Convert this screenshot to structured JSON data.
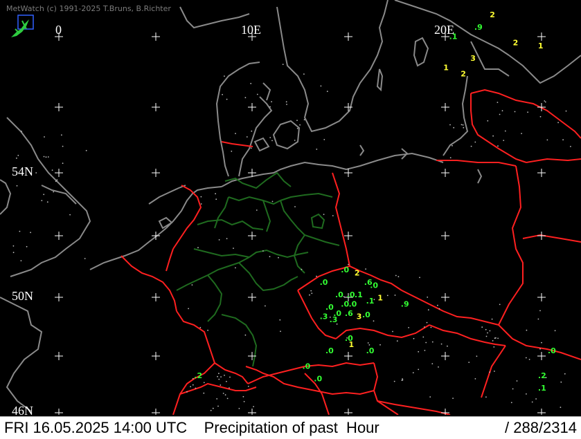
{
  "header": {
    "credit": "MetWatch  (c) 1991-2025 T.Bruns, B.Richter"
  },
  "grid_labels": {
    "lon_0": "0",
    "lon_10": "10E",
    "lon_20": "20E",
    "lat_54": "54N",
    "lat_50": "50N",
    "lat_46": "46N"
  },
  "footer": {
    "datetime": "FRI 16.05.2025 14:00 UTC",
    "title": "Precipitation of past  Hour",
    "count": "/ 288/2314"
  },
  "colors": {
    "background": "#000000",
    "coast": "#8a8a8a",
    "border": "#ff1a1a",
    "state_border": "#1f6b1f",
    "value_green": "#33ff33",
    "value_yellow": "#ffff33"
  },
  "observations": [
    {
      "lat": 58.6,
      "lon": 21.5,
      "value": ".9",
      "color": "green"
    },
    {
      "lat": 58.3,
      "lon": 20.2,
      "value": ".1",
      "color": "green"
    },
    {
      "lat": 58.1,
      "lon": 23.5,
      "value": "2",
      "color": "yellow"
    },
    {
      "lat": 58.0,
      "lon": 24.8,
      "value": "1",
      "color": "yellow"
    },
    {
      "lat": 57.6,
      "lon": 21.3,
      "value": "3",
      "color": "yellow"
    },
    {
      "lat": 57.3,
      "lon": 19.9,
      "value": "1",
      "color": "yellow"
    },
    {
      "lat": 57.1,
      "lon": 20.8,
      "value": "2",
      "color": "yellow"
    },
    {
      "lat": 59.0,
      "lon": 22.3,
      "value": "2",
      "color": "yellow"
    },
    {
      "lat": 50.8,
      "lon": 14.6,
      "value": ".0",
      "color": "green"
    },
    {
      "lat": 50.7,
      "lon": 15.3,
      "value": "2",
      "color": "yellow"
    },
    {
      "lat": 50.4,
      "lon": 15.8,
      "value": ".6",
      "color": "green"
    },
    {
      "lat": 50.3,
      "lon": 16.1,
      "value": ".0",
      "color": "green"
    },
    {
      "lat": 50.4,
      "lon": 13.5,
      "value": ".0",
      "color": "green"
    },
    {
      "lat": 50.0,
      "lon": 14.3,
      "value": ".0",
      "color": "green"
    },
    {
      "lat": 50.0,
      "lon": 14.9,
      "value": ".0",
      "color": "green"
    },
    {
      "lat": 50.0,
      "lon": 15.3,
      "value": ".1",
      "color": "green"
    },
    {
      "lat": 49.9,
      "lon": 16.5,
      "value": "1",
      "color": "yellow"
    },
    {
      "lat": 49.8,
      "lon": 15.9,
      "value": ".1",
      "color": "green"
    },
    {
      "lat": 49.7,
      "lon": 14.6,
      "value": ".0",
      "color": "green"
    },
    {
      "lat": 49.7,
      "lon": 15.0,
      "value": ".0",
      "color": "green"
    },
    {
      "lat": 49.7,
      "lon": 17.7,
      "value": ".9",
      "color": "green"
    },
    {
      "lat": 49.6,
      "lon": 13.8,
      "value": ".0",
      "color": "green"
    },
    {
      "lat": 49.4,
      "lon": 14.2,
      "value": ".0",
      "color": "green"
    },
    {
      "lat": 49.4,
      "lon": 14.8,
      "value": ".6",
      "color": "green"
    },
    {
      "lat": 49.3,
      "lon": 15.4,
      "value": "3",
      "color": "yellow"
    },
    {
      "lat": 49.35,
      "lon": 15.7,
      "value": ".0",
      "color": "green"
    },
    {
      "lat": 49.3,
      "lon": 13.5,
      "value": ".3",
      "color": "green"
    },
    {
      "lat": 49.2,
      "lon": 14.0,
      "value": ".3",
      "color": "green"
    },
    {
      "lat": 48.6,
      "lon": 14.8,
      "value": ".0",
      "color": "green"
    },
    {
      "lat": 48.4,
      "lon": 15.0,
      "value": "1",
      "color": "yellow"
    },
    {
      "lat": 48.2,
      "lon": 15.9,
      "value": ".0",
      "color": "green"
    },
    {
      "lat": 48.2,
      "lon": 13.8,
      "value": ".0",
      "color": "green"
    },
    {
      "lat": 47.7,
      "lon": 12.6,
      "value": ".0",
      "color": "green"
    },
    {
      "lat": 47.3,
      "lon": 13.2,
      "value": ".0",
      "color": "green"
    },
    {
      "lat": 47.4,
      "lon": 7.0,
      "value": ".2",
      "color": "green"
    },
    {
      "lat": 47.4,
      "lon": 24.8,
      "value": ".2",
      "color": "green"
    },
    {
      "lat": 47.0,
      "lon": 24.8,
      "value": ".1",
      "color": "green"
    },
    {
      "lat": 48.2,
      "lon": 25.3,
      "value": ".0",
      "color": "green"
    },
    {
      "lat": 45.9,
      "lon": 22.2,
      "value": "1",
      "color": "yellow"
    }
  ]
}
